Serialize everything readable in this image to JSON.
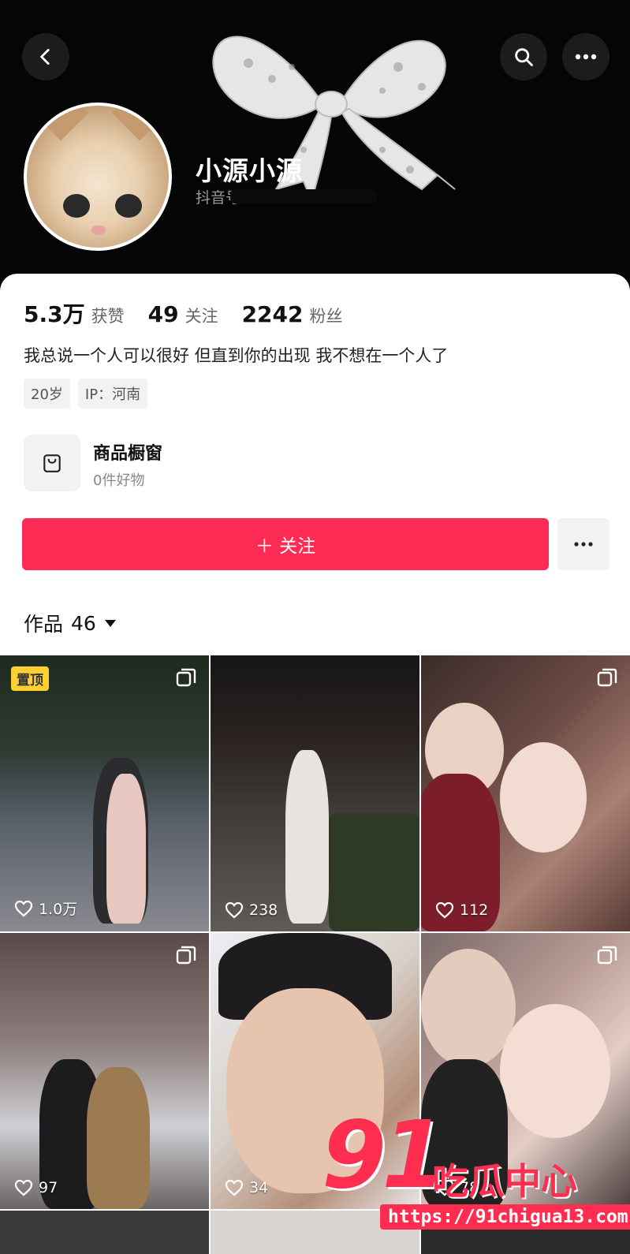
{
  "profile": {
    "name": "小源小源",
    "douyin_prefix": "抖音号"
  },
  "stats": [
    {
      "value": "5.3万",
      "label": "获赞"
    },
    {
      "value": "49",
      "label": "关注"
    },
    {
      "value": "2242",
      "label": "粉丝"
    }
  ],
  "bio": "我总说一个人可以很好 但直到你的出现 我不想在一个人了",
  "tags": [
    "20岁",
    "IP：河南"
  ],
  "shop": {
    "title": "商品橱窗",
    "subtitle": "0件好物"
  },
  "follow": {
    "label": "＋ 关注"
  },
  "works": {
    "label": "作品",
    "count": "46"
  },
  "grid": [
    {
      "likes": "1.0万",
      "pinned": "置顶"
    },
    {
      "likes": "238"
    },
    {
      "likes": "112"
    },
    {
      "likes": "97"
    },
    {
      "likes": "34"
    },
    {
      "likes": "78"
    }
  ],
  "watermark": {
    "number": "91",
    "text": "吃瓜中心",
    "url": "https://91chigua13.com"
  },
  "colors": {
    "accent": "#fe2c55",
    "pin": "#fcd031",
    "watermark": "#ff2d4f"
  }
}
